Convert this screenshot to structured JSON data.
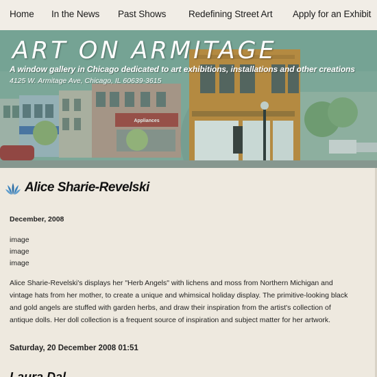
{
  "nav": {
    "items": [
      {
        "label": "Home"
      },
      {
        "label": "In the News"
      },
      {
        "label": "Past Shows"
      },
      {
        "label": "Redefining Street Art"
      },
      {
        "label": "Apply for an Exhibit"
      }
    ]
  },
  "banner": {
    "title": "ART ON ARMITAGE",
    "tagline": "A window gallery in Chicago dedicated to art exhibitions, installations and other creations",
    "address": "4125 W. Armitage Ave, Chicago, IL 60639-3615",
    "storefront_sign": "Appliances"
  },
  "article": {
    "icon": "lotus-logo-icon",
    "title": "Alice Sharie-Revelski",
    "date": "December, 2008",
    "images": [
      "image",
      "image",
      "image"
    ],
    "body": "Alice Sharie-Revelski's displays her \"Herb Angels\" with lichens and moss from Northern Michigan and vintage hats from her mother, to create a unique and whimsical holiday display. The primitive-looking black and gold angels are stuffed with garden herbs, and draw their inspiration from the artist's collection of antique dolls. Her doll collection is a frequent source of inspiration and subject matter for her artwork.",
    "timestamp": "Saturday, 20 December 2008 01:51"
  },
  "next_article": {
    "title": "Laura Dal..."
  },
  "colors": {
    "background": "#eee9df",
    "banner_tint": "#7aa899",
    "highlight_building": "#c8842c"
  }
}
